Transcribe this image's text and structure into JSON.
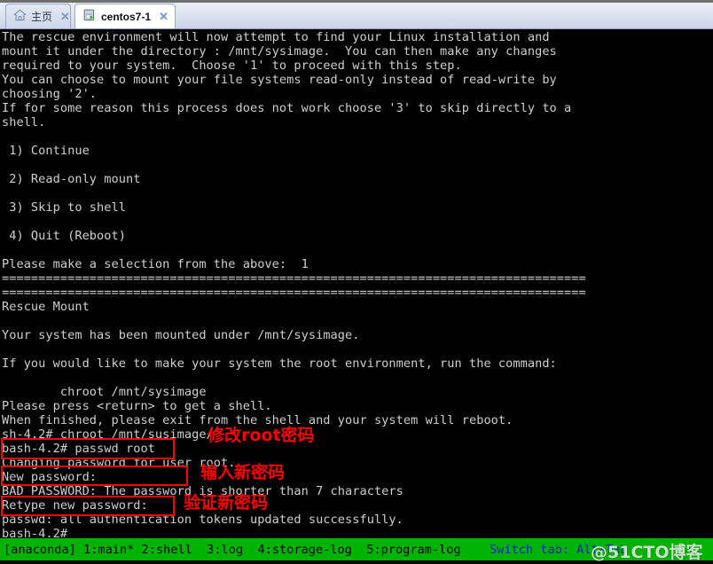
{
  "tabs": [
    {
      "label": "主页",
      "icon": "home-icon",
      "close": "✕",
      "active": false
    },
    {
      "label": "centos7-1",
      "icon": "vm-icon",
      "close": "✕",
      "active": true
    }
  ],
  "terminal": {
    "lines": [
      "The rescue environment will now attempt to find your Linux installation and",
      "mount it under the directory : /mnt/sysimage.  You can then make any changes",
      "required to your system.  Choose '1' to proceed with this step.",
      "You can choose to mount your file systems read-only instead of read-write by",
      "choosing '2'.",
      "If for some reason this process does not work choose '3' to skip directly to a",
      "shell.",
      "",
      " 1) Continue",
      "",
      " 2) Read-only mount",
      "",
      " 3) Skip to shell",
      "",
      " 4) Quit (Reboot)",
      "",
      "Please make a selection from the above:  1",
      "================================================================================",
      "================================================================================",
      "Rescue Mount",
      "",
      "Your system has been mounted under /mnt/sysimage.",
      "",
      "If you would like to make your system the root environment, run the command:",
      "",
      "        chroot /mnt/sysimage",
      "Please press <return> to get a shell.",
      "When finished, please exit from the shell and your system will reboot.",
      "sh-4.2# chroot /mnt/susimage/",
      "bash-4.2# passwd root",
      "Changing password for user root.",
      "New password:",
      "BAD PASSWORD: The password is shorter than 7 characters",
      "Retype new password:",
      "passwd: all authentication tokens updated successfully.",
      "bash-4.2#"
    ]
  },
  "annotations": {
    "boxes": [
      {
        "name": "passwd-root-command-box"
      },
      {
        "name": "new-password-prompt-box"
      },
      {
        "name": "retype-password-prompt-box"
      }
    ],
    "labels": [
      "修改root密码",
      "输入新密码",
      "验证新密码"
    ]
  },
  "statusbar": {
    "session": "[anaconda]",
    "windows": " 1:main* 2:shell  3:log  4:storage-log  5:program-log",
    "hint": "Switch tab: Alt+Tab"
  },
  "watermark": "@51CTO博客",
  "colors": {
    "terminal_bg": "#000000",
    "terminal_fg": "#cfcfcf",
    "annotation_red": "#fe0000",
    "status_green": "#00b300",
    "status_hint_blue": "#1a1ad6",
    "tabbar_bg": "#dfe5f1"
  }
}
